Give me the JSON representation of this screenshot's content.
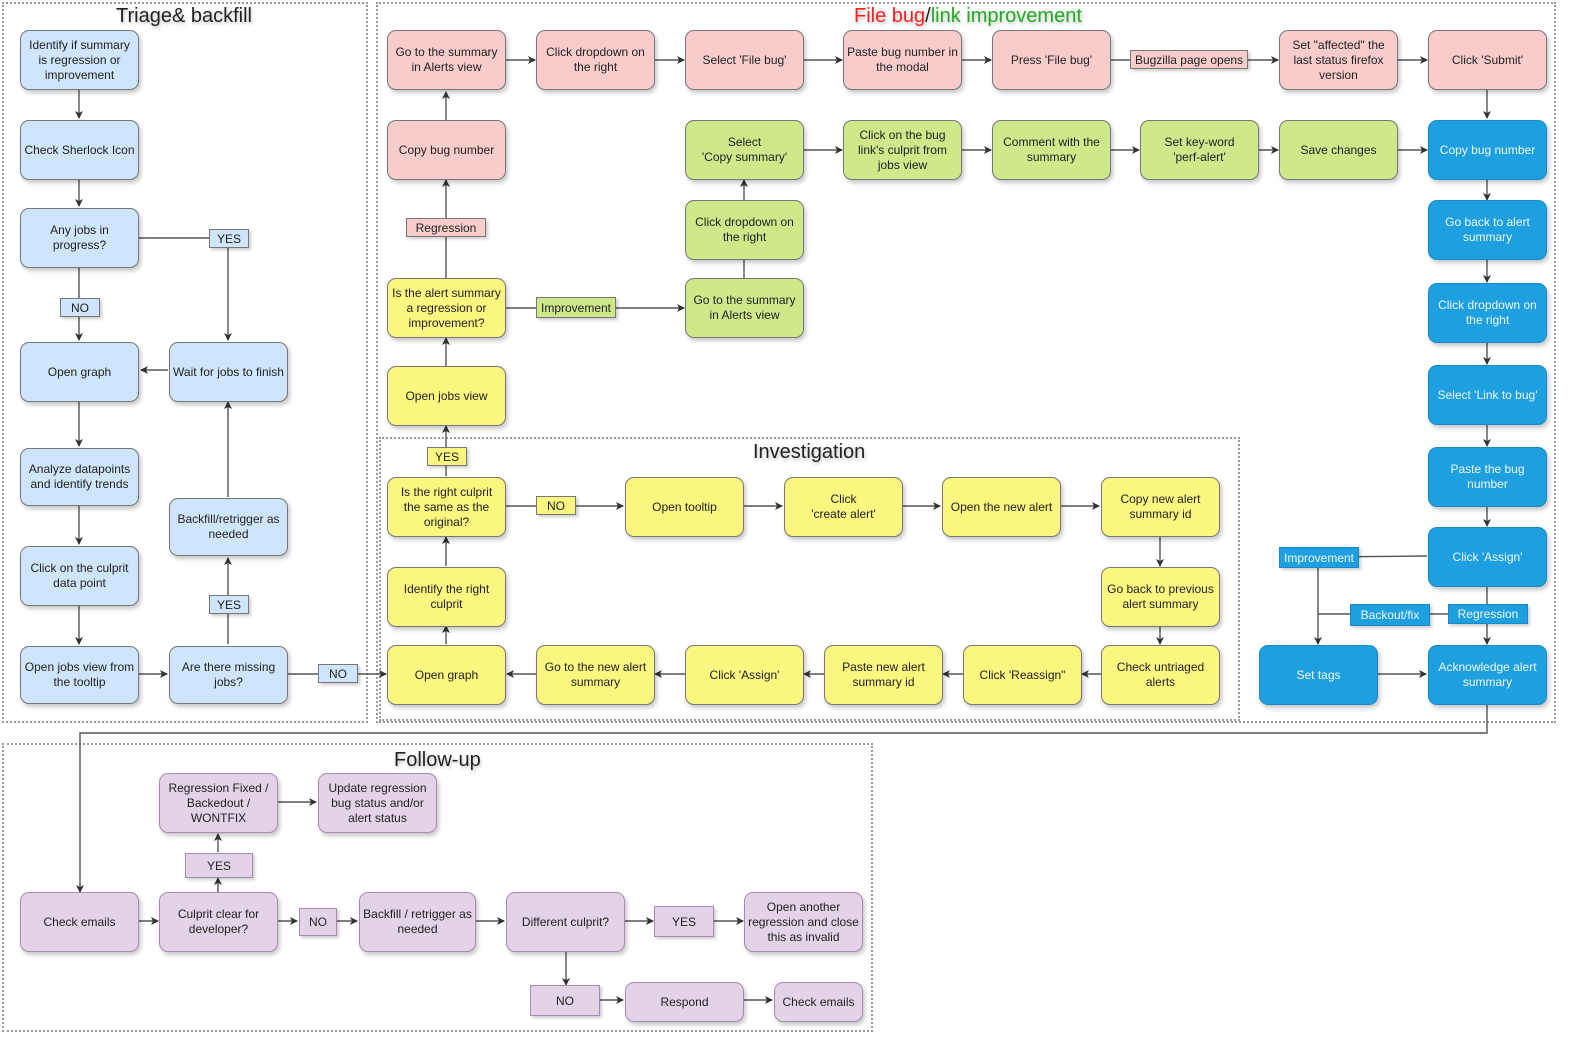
{
  "groups": {
    "triage": {
      "title": "Triage& backfill"
    },
    "file_bug": {
      "title_part1": "File bug",
      "title_sep": "/",
      "title_part2": "link improvement"
    },
    "investigation": {
      "title": "Investigation"
    },
    "followup": {
      "title": "Follow-up"
    }
  },
  "colors": {
    "triage": "#cfe5fb",
    "file_bug": "#f9cccc",
    "link_improvement": "#cfe88a",
    "investigation": "#fbf67f",
    "finalize": "#1e9fe0",
    "followup": "#e2d4e6",
    "title_red": "#ff2020",
    "title_green": "#22aa22"
  },
  "nodes": {
    "t_identify": "Identify if summary is regression or improvement",
    "t_sherlock": "Check Sherlock Icon",
    "t_jobs_progress": "Any jobs in progress?",
    "t_open_graph": "Open graph",
    "t_wait": "Wait for jobs to finish",
    "t_analyze": "Analyze datapoints and identify trends",
    "t_backfill": "Backfill/retrigger as needed",
    "t_click_culprit": "Click on the culprit data point",
    "t_open_jobs_tooltip": "Open jobs view from the tooltip",
    "t_missing": "Are there missing jobs?",
    "f_goto_summary": "Go to the summary in Alerts view",
    "f_click_dropdown": "Click dropdown on the right",
    "f_select_file_bug": "Select 'File bug'",
    "f_paste_bug": "Paste bug number in the modal",
    "f_press_file_bug": "Press 'File bug'",
    "f_set_affected": "Set \"affected\" the last status firefox version",
    "f_click_submit": "Click 'Submit'",
    "f_copy_bug": "Copy bug number",
    "g_select_copy": "Select\n'Copy summary'",
    "g_click_bug_link": "Click on the bug link's culprit from jobs view",
    "g_comment": "Comment with the summary",
    "g_keyword": "Set key-word\n'perf-alert'",
    "g_save": "Save changes",
    "g_click_dropdown": "Click dropdown on the right",
    "g_goto_summary": "Go to the summary in Alerts view",
    "y_is_regression": "Is the alert summary a regression or improvement?",
    "y_open_jobs": "Open jobs view",
    "i_right_culprit": "Is the right culprit the same as the original?",
    "i_open_tooltip": "Open tooltip",
    "i_create_alert": "Click\n'create alert'",
    "i_open_new_alert": "Open the new alert",
    "i_copy_new_id": "Copy new alert summary id",
    "i_identify_culprit": "Identify the right culprit",
    "i_go_back_prev": "Go back to previous alert summary",
    "i_open_graph": "Open graph",
    "i_goto_new_summary": "Go to the new alert summary",
    "i_click_assign": "Click 'Assign'",
    "i_paste_new_id": "Paste new alert summary id",
    "i_click_reassign": "Click 'Reassign\"",
    "i_check_untriaged": "Check untriaged alerts",
    "b_copy_bug": "Copy bug number",
    "b_go_back": "Go back to alert summary",
    "b_click_dropdown": "Click dropdown on the right",
    "b_select_link": "Select 'Link to bug'",
    "b_paste_bug": "Paste the bug number",
    "b_click_assign": "Click 'Assign'",
    "b_set_tags": "Set tags",
    "b_acknowledge": "Acknowledge alert summary",
    "p_check_emails": "Check emails",
    "p_culprit_clear": "Culprit clear for developer?",
    "p_fixed": "Regression Fixed / Backedout / WONTFIX",
    "p_update": "Update regression bug status and/or alert status",
    "p_backfill": "Backfill / retrigger as needed",
    "p_different": "Different culprit?",
    "p_open_another": "Open another regression and close this as invalid",
    "p_respond": "Respond",
    "p_check_emails2": "Check emails"
  },
  "edge_labels": {
    "t_yes1": "YES",
    "t_no1": "NO",
    "t_yes2": "YES",
    "t_no2": "NO",
    "f_bugzilla": "Bugzilla page opens",
    "y_regression": "Regression",
    "y_improvement": "Improvement",
    "i_yes": "YES",
    "i_no": "NO",
    "b_improvement": "Improvement",
    "b_regression": "Regression",
    "b_backout": "Backout/fix",
    "p_yes1": "YES",
    "p_no1": "NO",
    "p_yes2": "YES",
    "p_no2": "NO"
  }
}
